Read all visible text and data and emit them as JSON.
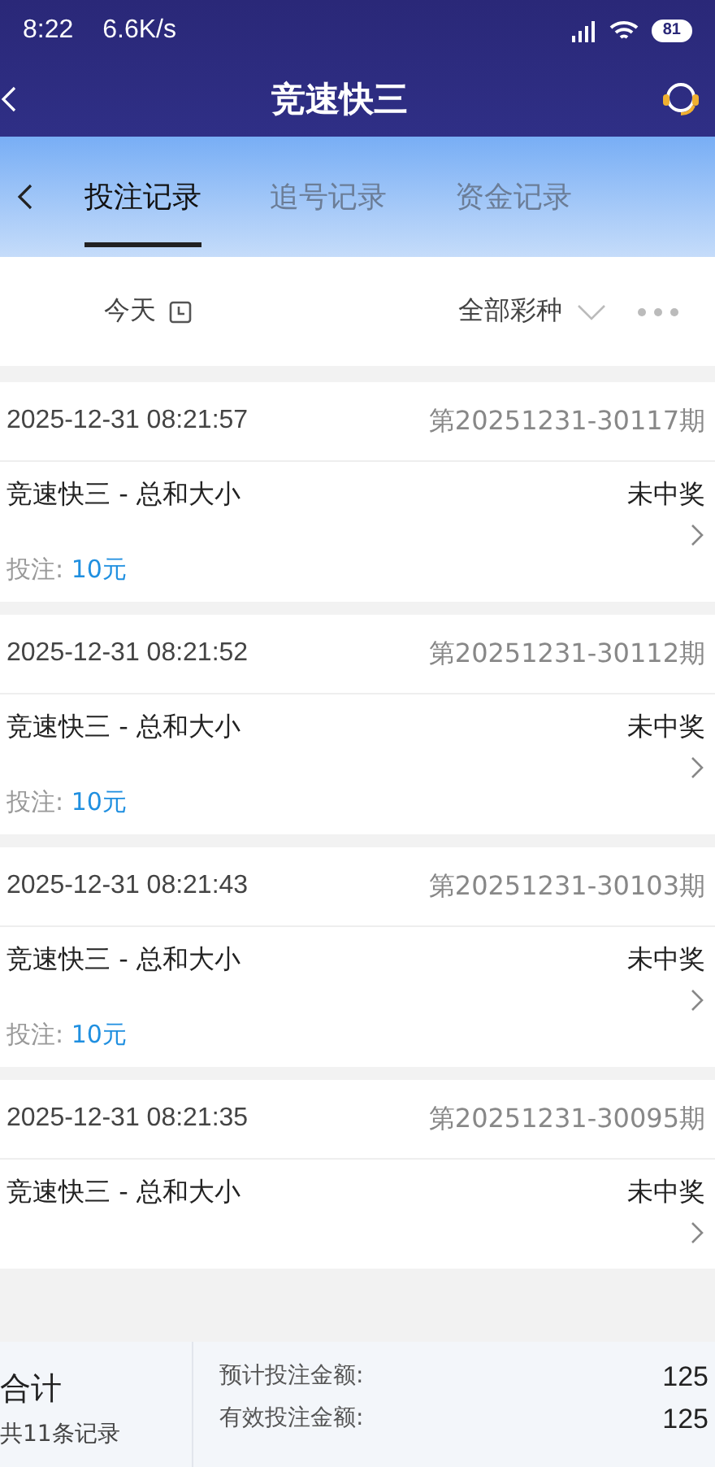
{
  "status_bar": {
    "time": "8:22",
    "speed": "6.6K/s",
    "battery": "81"
  },
  "window": {
    "title": "竞速快三"
  },
  "tabs": [
    {
      "label": "投注记录",
      "selected": true
    },
    {
      "label": "追号记录",
      "selected": false
    },
    {
      "label": "资金记录",
      "selected": false
    }
  ],
  "filters": {
    "date": "今天",
    "lottery": "全部彩种"
  },
  "records": [
    {
      "time": "2025-12-31 08:21:57",
      "issue": "第20251231-30117期",
      "name": "竞速快三 - 总和大小",
      "result": "未中奖",
      "bet_label": "投注:",
      "bet_amount": "10元"
    },
    {
      "time": "2025-12-31 08:21:52",
      "issue": "第20251231-30112期",
      "name": "竞速快三 - 总和大小",
      "result": "未中奖",
      "bet_label": "投注:",
      "bet_amount": "10元"
    },
    {
      "time": "2025-12-31 08:21:43",
      "issue": "第20251231-30103期",
      "name": "竞速快三 - 总和大小",
      "result": "未中奖",
      "bet_label": "投注:",
      "bet_amount": "10元"
    },
    {
      "time": "2025-12-31 08:21:35",
      "issue": "第20251231-30095期",
      "name": "竞速快三 - 总和大小",
      "result": "未中奖"
    }
  ],
  "summary": {
    "title": "合计",
    "count": "共11条记录",
    "rows": [
      {
        "label": "预计投注金额:",
        "value": "125"
      },
      {
        "label": "有效投注金额:",
        "value": "125"
      }
    ]
  }
}
